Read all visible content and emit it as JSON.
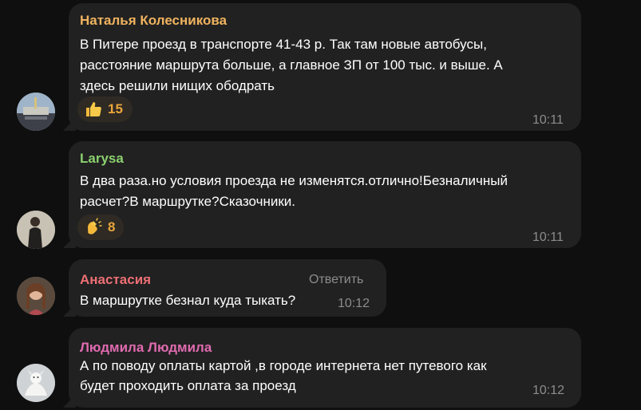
{
  "messages": [
    {
      "author": "Наталья Колесникова",
      "author_color": "#f0b35f",
      "lines": [
        "В Питере проезд в транспорте 41-43 р. Так там новые автобусы,",
        "расстояние маршрута больше, а главное ЗП от 100 тыс. и выше. А",
        "здесь решили нищих ободрать"
      ],
      "reaction_icon": "thumbs-up-icon",
      "reaction_count": "15",
      "time": "10:11"
    },
    {
      "author": "Larysa",
      "author_color": "#8bd06e",
      "lines": [
        "В два раза.но условия проезда не изменятся.отлично!Безналичный",
        "расчет?В маршрутке?Сказочники."
      ],
      "reaction_icon": "clapping-hands-icon",
      "reaction_count": "8",
      "time": "10:11"
    },
    {
      "author": "Анастасия",
      "author_color": "#ec6f74",
      "reply_label": "Ответить",
      "lines": [
        "В маршрутке безнал куда тыкать?"
      ],
      "time": "10:12"
    },
    {
      "author": "Людмила Людмила",
      "author_color": "#e06bb0",
      "lines": [
        "А по поводу оплаты картой ,в городе интернета нет путевого как",
        "будет проходить оплата за проезд"
      ],
      "time": "10:12"
    }
  ],
  "colors": {
    "background": "#0f0f0f",
    "bubble": "#212121",
    "text": "#ffffff",
    "meta": "#8c8c8c",
    "reaction_bg": "#2f2a24",
    "reaction_count": "#e9a53a"
  }
}
